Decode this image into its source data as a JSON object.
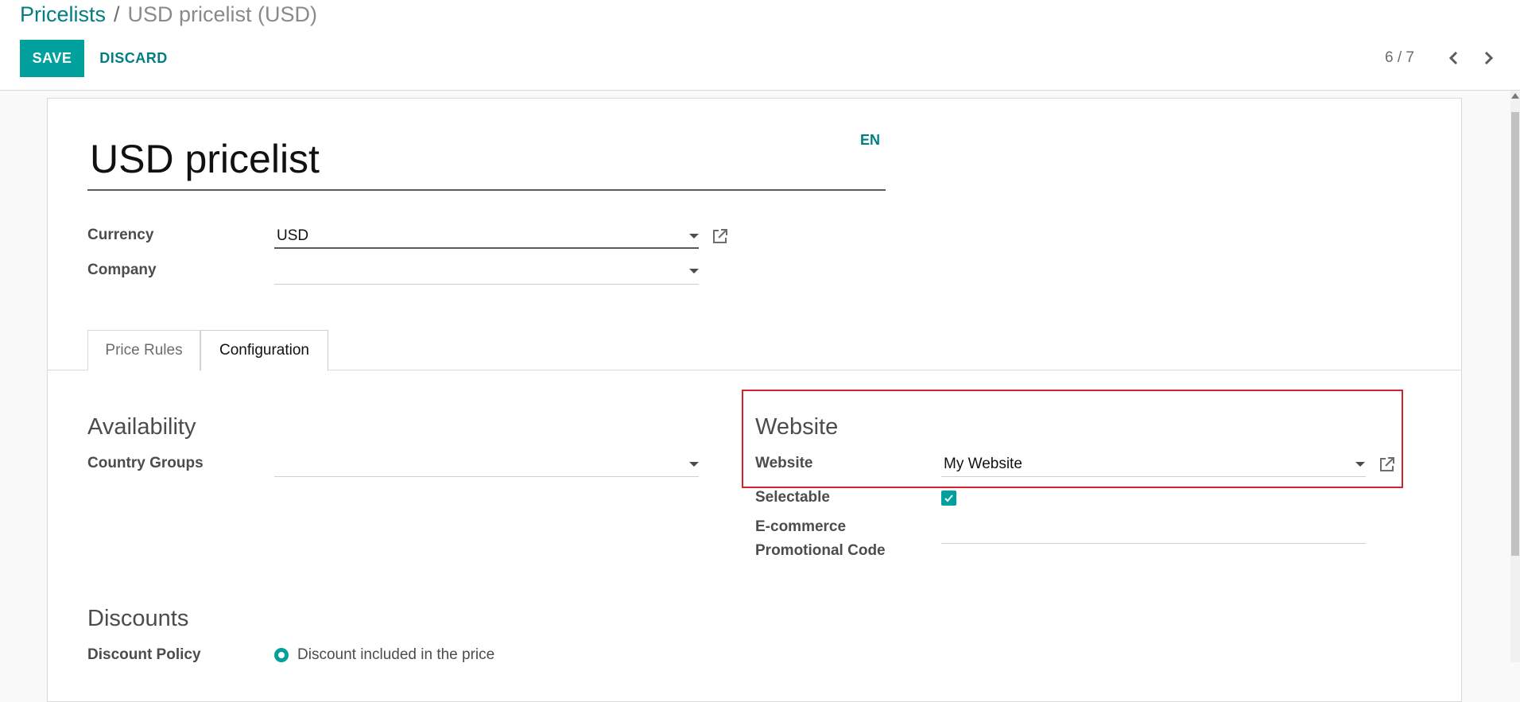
{
  "breadcrumb": {
    "parent": "Pricelists",
    "separator": "/",
    "current": "USD pricelist (USD)"
  },
  "toolbar": {
    "save_label": "SAVE",
    "discard_label": "DISCARD"
  },
  "pager": {
    "value": "6 / 7"
  },
  "form": {
    "name": "USD pricelist",
    "lang_badge": "EN",
    "currency_label": "Currency",
    "currency_value": "USD",
    "company_label": "Company",
    "company_value": ""
  },
  "tabs": [
    {
      "label": "Price Rules",
      "active": false
    },
    {
      "label": "Configuration",
      "active": true
    }
  ],
  "availability": {
    "title": "Availability",
    "country_groups_label": "Country Groups",
    "country_groups_value": ""
  },
  "website": {
    "title": "Website",
    "website_label": "Website",
    "website_value": "My Website",
    "selectable_label": "Selectable",
    "selectable_checked": true,
    "promo_label_line1": "E-commerce",
    "promo_label_line2": "Promotional Code",
    "promo_value": ""
  },
  "discounts": {
    "title": "Discounts",
    "policy_label": "Discount Policy",
    "policy_option": "Discount included in the price"
  },
  "colors": {
    "primary": "#00a09d",
    "link": "#017e84",
    "highlight": "#d4232f"
  }
}
